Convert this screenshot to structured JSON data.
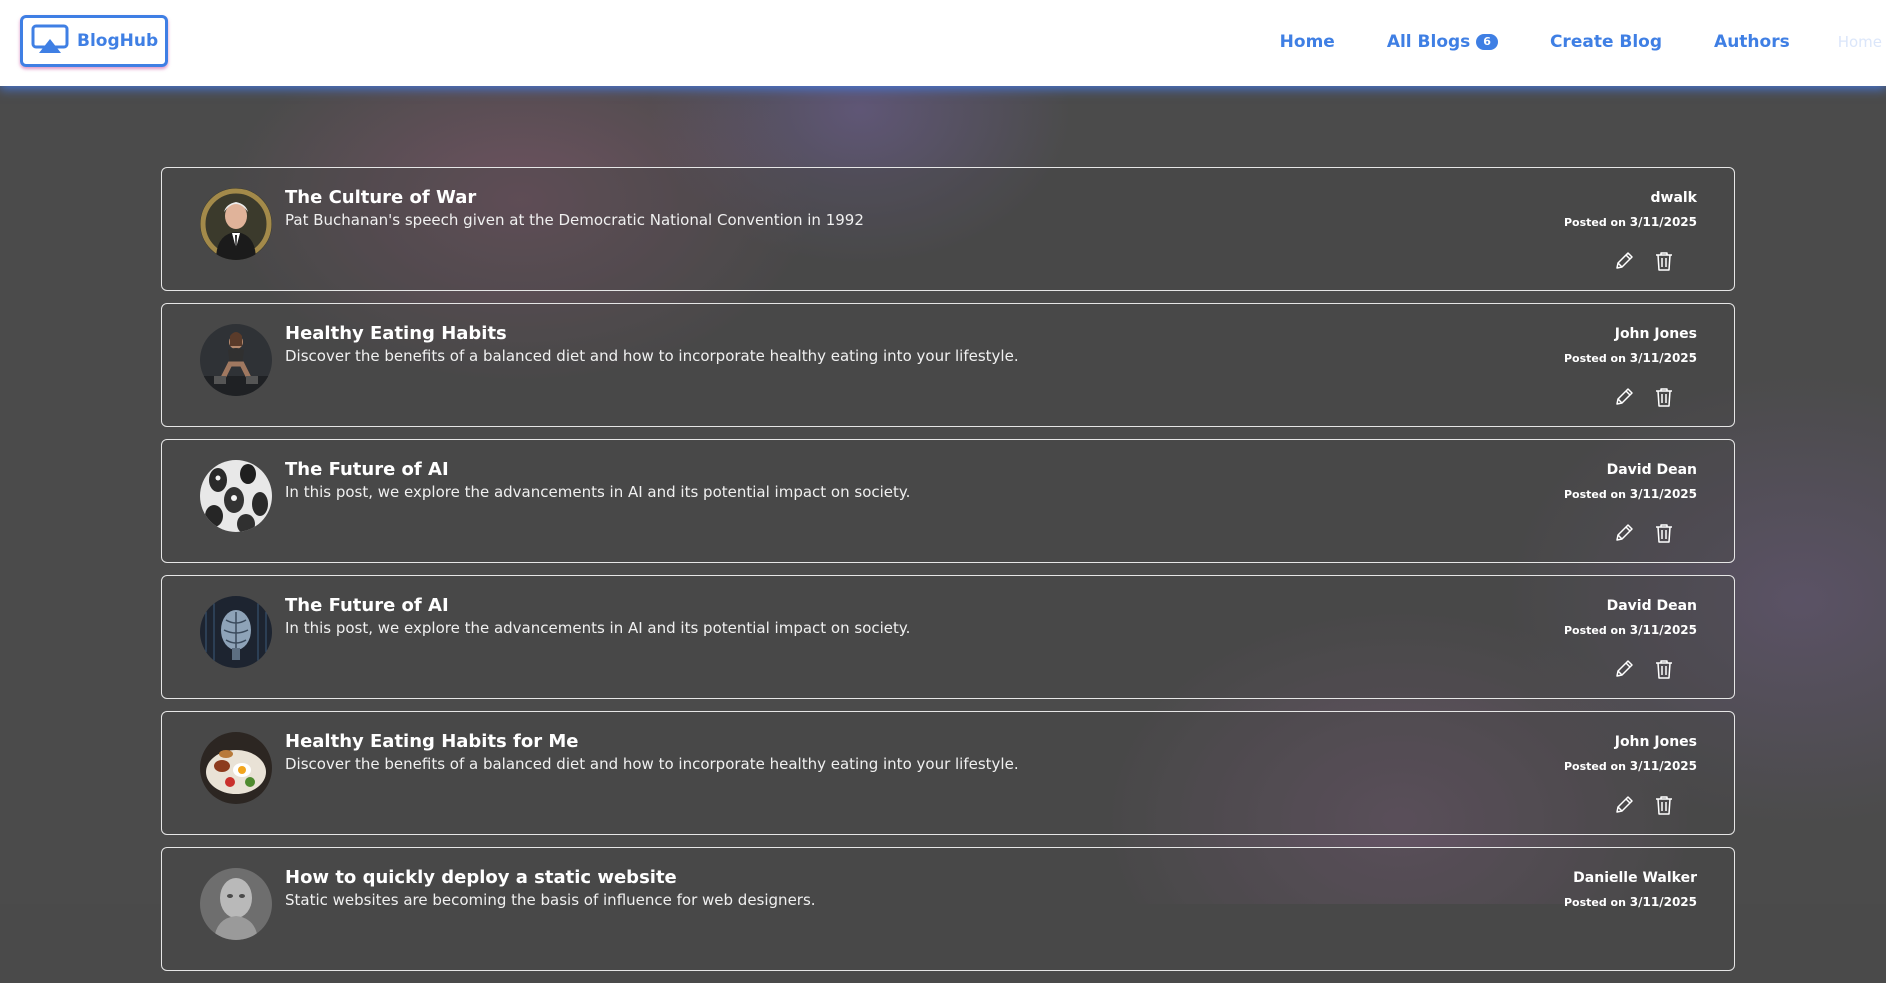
{
  "header": {
    "logo_text": "BlogHub",
    "nav": [
      {
        "label": "Home"
      },
      {
        "label": "All Blogs",
        "badge": "6"
      },
      {
        "label": "Create Blog"
      },
      {
        "label": "Authors"
      },
      {
        "label": "Home"
      }
    ]
  },
  "posts": [
    {
      "title": "The Culture of War",
      "description": "Pat Buchanan's speech given at the Democratic National Convention in 1992",
      "author": "dwalk",
      "posted_prefix": "Posted on",
      "date": "3/11/2025",
      "avatar": "portrait-photo"
    },
    {
      "title": "Healthy Eating Habits",
      "description": "Discover the benefits of a balanced diet and how to incorporate healthy eating into your lifestyle.",
      "author": "John Jones",
      "posted_prefix": "Posted on",
      "date": "3/11/2025",
      "avatar": "gym-photo"
    },
    {
      "title": "The Future of AI",
      "description": "In this post, we explore the advancements in AI and its potential impact on society.",
      "author": "David Dean",
      "posted_prefix": "Posted on",
      "date": "3/11/2025",
      "avatar": "robots-photo"
    },
    {
      "title": "The Future of AI",
      "description": "In this post, we explore the advancements in AI and its potential impact on society.",
      "author": "David Dean",
      "posted_prefix": "Posted on",
      "date": "3/11/2025",
      "avatar": "brain-photo"
    },
    {
      "title": "Healthy Eating Habits for Me",
      "description": "Discover the benefits of a balanced diet and how to incorporate healthy eating into your lifestyle.",
      "author": "John Jones",
      "posted_prefix": "Posted on",
      "date": "3/11/2025",
      "avatar": "food-photo"
    },
    {
      "title": "How to quickly deploy a static website",
      "description": "Static websites are becoming the basis of influence for web designers.",
      "author": "Danielle Walker",
      "posted_prefix": "Posted on",
      "date": "3/11/2025",
      "avatar": "statue-photo"
    }
  ],
  "icons": {
    "edit": "pencil-icon",
    "delete": "trash-icon",
    "logo": "airplay-icon"
  },
  "colors": {
    "accent": "#3f7fe4",
    "background": "#4b4b4b"
  }
}
